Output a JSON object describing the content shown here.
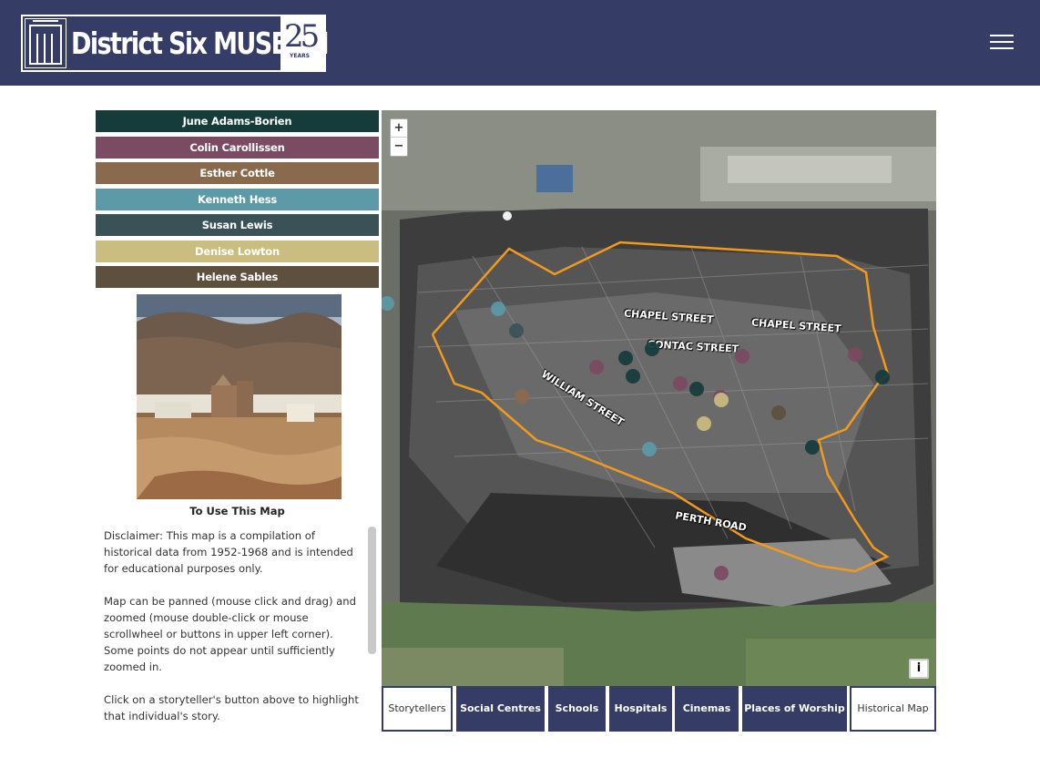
{
  "header": {
    "logo_text": "District Six MUSEUM",
    "anniversary": "25",
    "anniversary_sub": "YEARS",
    "menu_icon": "hamburger-menu-icon",
    "bar_color": "#353c66"
  },
  "storytellers": [
    {
      "name": "June Adams-Borien",
      "color": "#153b3b"
    },
    {
      "name": "Colin Carollissen",
      "color": "#7b4a63"
    },
    {
      "name": "Esther Cottle",
      "color": "#8a6a4d"
    },
    {
      "name": "Kenneth Hess",
      "color": "#5b9aa6"
    },
    {
      "name": "Susan Lewis",
      "color": "#3a5257"
    },
    {
      "name": "Denise Lowton",
      "color": "#cbbd7f"
    },
    {
      "name": "Helene Sables",
      "color": "#5d503d"
    }
  ],
  "sidebar": {
    "how_to_title": "To Use This Map",
    "paragraphs": [
      "Disclaimer: This map is a compilation of historical data from 1952-1968 and is intended for educational purposes only.",
      "Map can be panned (mouse click and drag) and zoomed (mouse double-click or mouse scrollwheel or buttons in upper left corner). Some points do not appear until sufficiently zoomed in.",
      "Click on a storyteller's button above to highlight that individual's story."
    ]
  },
  "map": {
    "zoom_in": "+",
    "zoom_out": "−",
    "info": "i",
    "street_labels": [
      "CHAPEL STREET",
      "CHAPEL STREET",
      "CONTAC STREET",
      "WILLIAM STREET",
      "PERTH ROAD"
    ],
    "boundary_color": "#f29a1e"
  },
  "tabs": [
    {
      "label": "Storytellers",
      "style": "light"
    },
    {
      "label": "Social Centres",
      "style": "dark"
    },
    {
      "label": "Schools",
      "style": "dark"
    },
    {
      "label": "Hospitals",
      "style": "dark"
    },
    {
      "label": "Cinemas",
      "style": "dark"
    },
    {
      "label": "Places of Worship",
      "style": "dark"
    },
    {
      "label": "Historical Map",
      "style": "light"
    }
  ]
}
